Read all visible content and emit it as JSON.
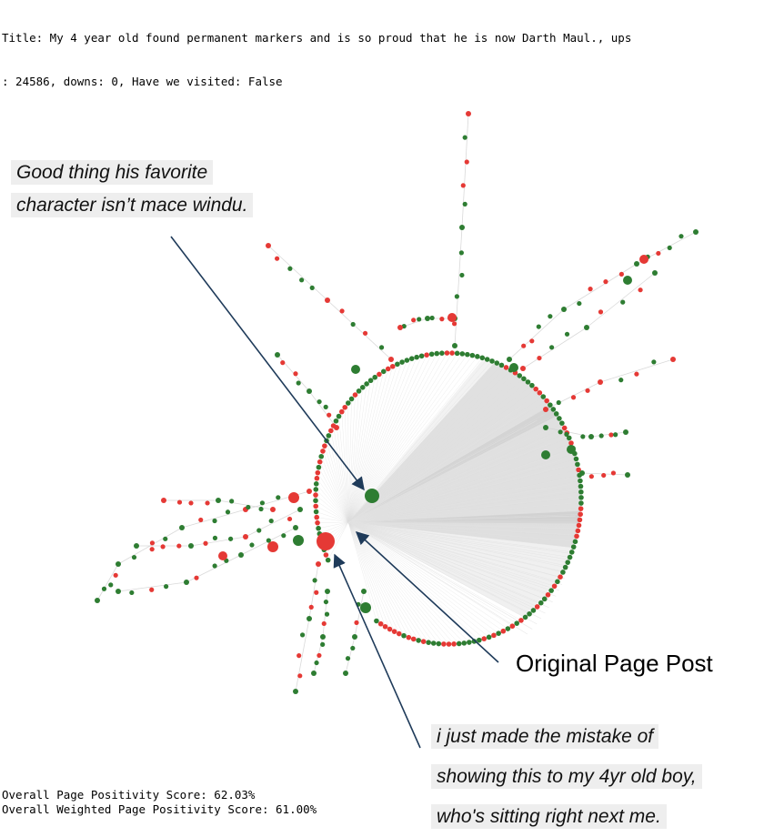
{
  "header": {
    "line1": "Title: My 4 year old found permanent markers and is so proud that he is now Darth Maul., ups",
    "line2": ": 24586, downs: 0, Have we visited: False"
  },
  "footer": {
    "positivity": "Overall Page Positivity Score: 62.03%",
    "weighted": "Overall Weighted Page Positivity Score: 61.00%"
  },
  "annotations": {
    "top_comment": [
      "Good thing his favorite",
      "character isn’t mace windu."
    ],
    "original_post": "Original Page Post",
    "bottom_comment": [
      "i just made the mistake of",
      "showing this to my 4yr old boy,",
      "who's sitting right next me."
    ]
  },
  "colors": {
    "positive_node": "#2e7d32",
    "negative_node": "#e53935",
    "arrow": "#1f3b5a",
    "edge": "#cccccc"
  }
}
